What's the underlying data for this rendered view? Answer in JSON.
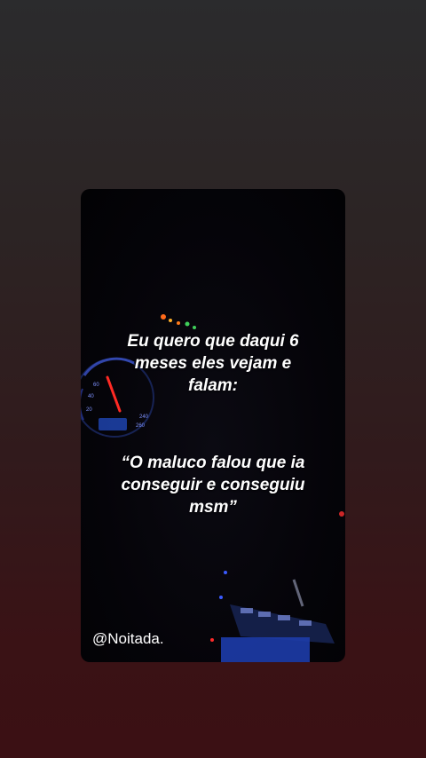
{
  "story": {
    "line1": "Eu quero que daqui 6",
    "line2": "meses eles vejam e",
    "line3": "falam:",
    "quote1": "“O maluco falou que ia",
    "quote2": "conseguir e conseguiu",
    "quote3": "msm”",
    "handle": "@Noitada."
  }
}
